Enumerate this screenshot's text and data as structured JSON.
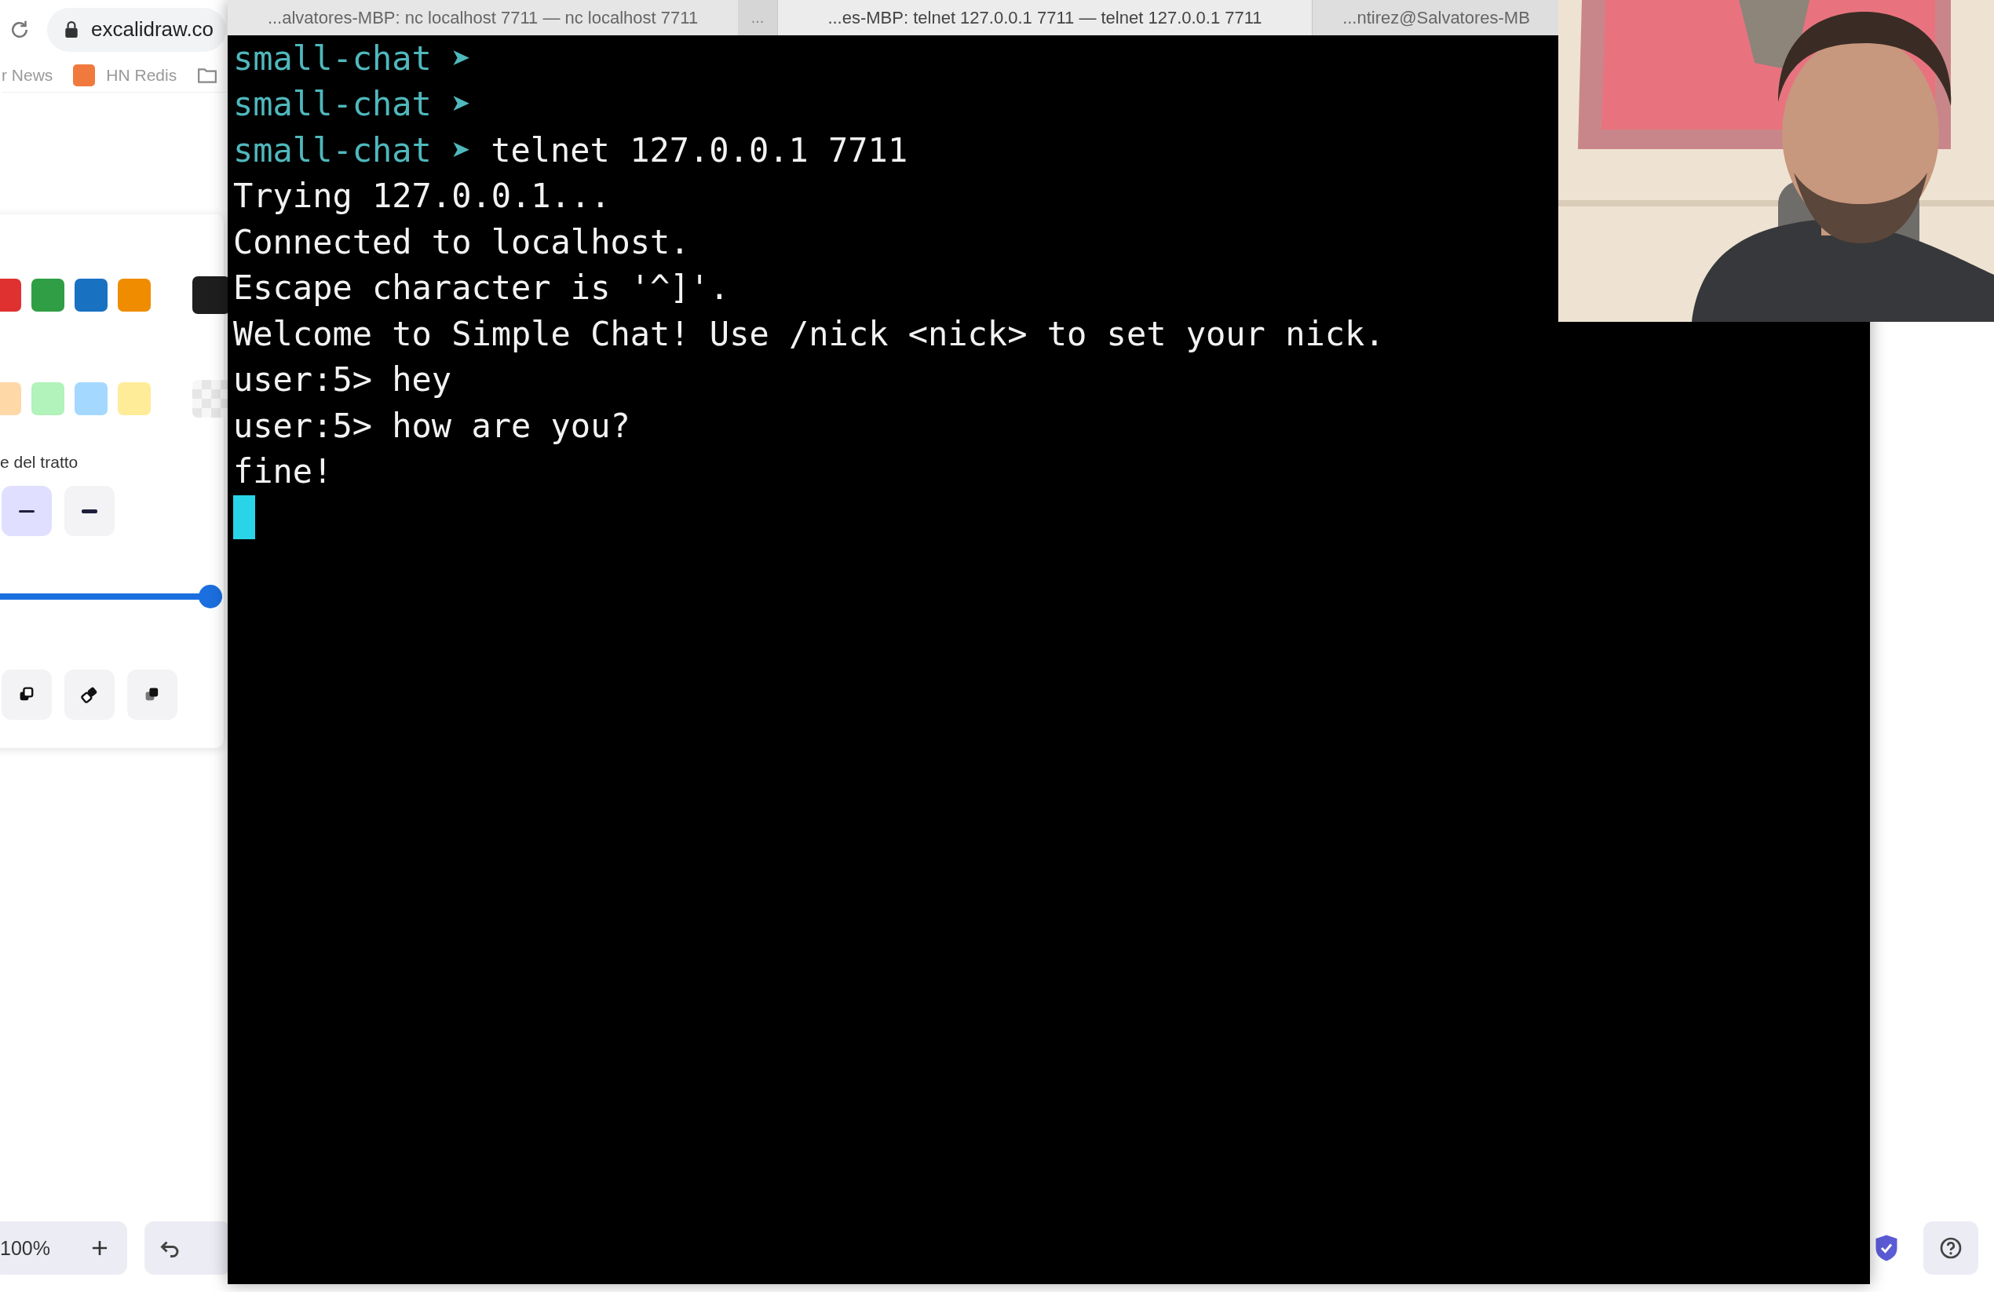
{
  "browser": {
    "address": "excalidraw.co",
    "bookmarks": [
      {
        "kind": "text",
        "label": "r News"
      },
      {
        "kind": "site",
        "label": "HN Redis"
      },
      {
        "kind": "folder"
      }
    ]
  },
  "panel": {
    "stroke_swatches": [
      {
        "color": "#e03131"
      },
      {
        "color": "#2f9e44"
      },
      {
        "color": "#1971c2"
      },
      {
        "color": "#f08c00"
      }
    ],
    "stroke_current": {
      "color": "#1e1e1e"
    },
    "background_swatches": [
      {
        "color": "#ffd8a8"
      },
      {
        "color": "#b2f2bb"
      },
      {
        "color": "#a5d8ff"
      },
      {
        "color": "#ffec99"
      }
    ],
    "background_current": {
      "kind": "transparent"
    },
    "stroke_width_label": "e del tratto",
    "stroke_widths": [
      {
        "selected": true
      },
      {
        "selected": false
      }
    ],
    "opacity": {
      "level": 1
    }
  },
  "footer": {
    "zoom": "100%"
  },
  "terminal": {
    "tabs": [
      {
        "title": "...alvatores-MBP: nc localhost 7711 — nc localhost 7711",
        "selected": false
      },
      {
        "title": "...es-MBP: telnet 127.0.0.1 7711 — telnet 127.0.0.1 7711",
        "selected": true
      },
      {
        "title": "...ntirez@Salvatores-MB",
        "selected": false
      }
    ],
    "tab_overflow": "...",
    "lines": [
      {
        "kind": "prompt",
        "prompt": "small-chat",
        "symbol": "➤"
      },
      {
        "kind": "prompt",
        "prompt": "small-chat",
        "symbol": "➤"
      },
      {
        "kind": "prompt",
        "prompt": "small-chat",
        "symbol": "➤",
        "command": "telnet 127.0.0.1 7711"
      },
      {
        "kind": "output",
        "text": "Trying 127.0.0.1..."
      },
      {
        "kind": "output",
        "text": "Connected to localhost."
      },
      {
        "kind": "output",
        "text": "Escape character is '^]'."
      },
      {
        "kind": "output",
        "text": "Welcome to Simple Chat! Use /nick <nick> to set your nick."
      },
      {
        "kind": "output",
        "text": "user:5> hey"
      },
      {
        "kind": "output",
        "text": "user:5> how are you?"
      },
      {
        "kind": "output",
        "text": "fine!"
      }
    ],
    "cursor_visible": true
  }
}
